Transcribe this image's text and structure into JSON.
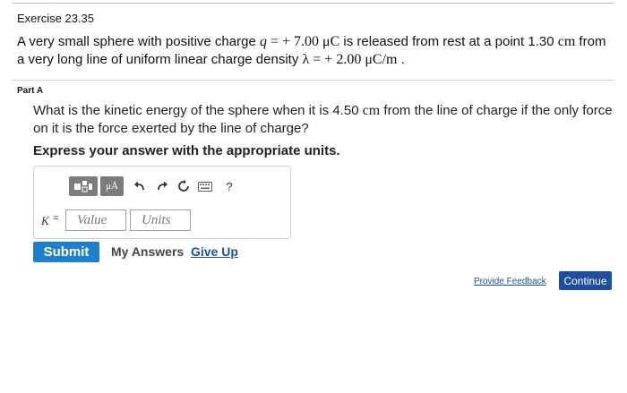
{
  "exercise": {
    "title": "Exercise 23.35"
  },
  "problem": {
    "text_1": "A very small sphere with positive charge ",
    "q_symbol": "q",
    "eq_1": " = + 7.00 ",
    "charge_unit": "μC",
    "text_2": " is released from rest at a point 1.30 ",
    "cm_unit": "cm",
    "text_3": " from a very long line of uniform linear charge density ",
    "lambda_symbol": "λ",
    "eq_2": " = + 2.00 ",
    "density_unit": "μC/m",
    "text_4": " ."
  },
  "part": {
    "label": "Part A"
  },
  "question": {
    "text_1": "What is the kinetic energy of the sphere when it is 4.50 ",
    "cm_unit": "cm",
    "text_2": " from the line of charge if the only force on it is the force exerted by the line of charge?"
  },
  "instruction": "Express your answer with the appropriate units.",
  "toolbar": {
    "units_label": "μÅ",
    "help_label": "?",
    "icons": [
      "templates-icon",
      "units-icon",
      "undo-icon",
      "redo-icon",
      "reset-icon",
      "keyboard-icon",
      "help-icon"
    ]
  },
  "answer": {
    "variable": "K",
    "equals": "=",
    "value_placeholder": "Value",
    "units_placeholder": "Units"
  },
  "actions": {
    "submit": "Submit",
    "my_answers": "My Answers",
    "give_up": "Give Up",
    "provide_feedback": "Provide Feedback",
    "continue": "Continue"
  },
  "colors": {
    "submit_bg": "#1f7fcc",
    "continue_bg": "#1f4f9a",
    "link": "#1b4fa0",
    "toolbar_button": "#7c7c7c"
  }
}
